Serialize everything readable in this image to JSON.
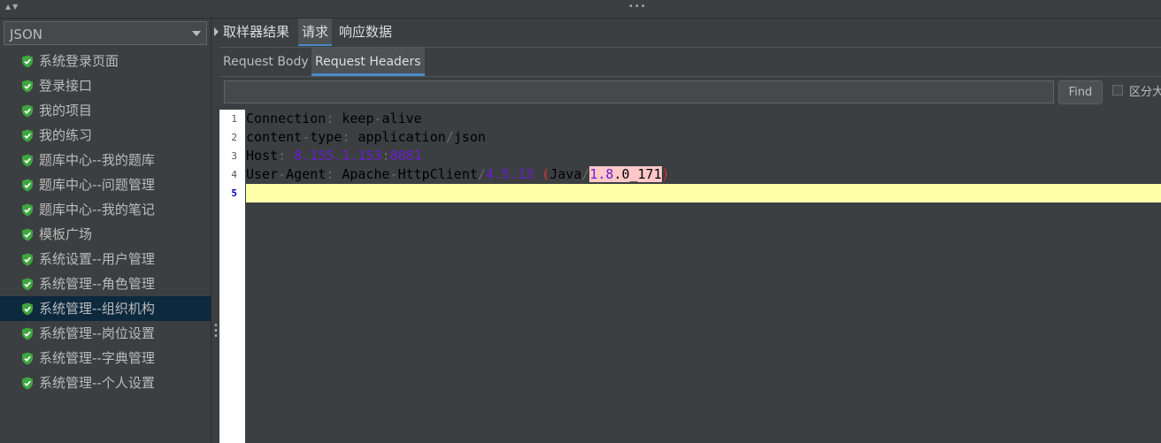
{
  "combo": {
    "value": "JSON"
  },
  "tree": [
    "系统登录页面",
    "登录接口",
    "我的项目",
    "我的练习",
    "题库中心--我的题库",
    "题库中心--问题管理",
    "题库中心--我的笔记",
    "模板广场",
    "系统设置--用户管理",
    "系统管理--角色管理",
    "系统管理--组织机构",
    "系统管理--岗位设置",
    "系统管理--字典管理",
    "系统管理--个人设置"
  ],
  "selected_index": 10,
  "tabs": [
    "取样器结果",
    "请求",
    "响应数据"
  ],
  "subtabs": [
    "Request Body",
    "Request Headers"
  ],
  "find": {
    "value": "",
    "button": "Find",
    "case_label": "区分大"
  },
  "line_numbers": [
    "1",
    "2",
    "3",
    "4",
    "5"
  ],
  "lines": {
    "l1": [
      "Connection",
      ": ",
      "keep",
      "-",
      "alive"
    ],
    "l2": [
      "content",
      "-",
      "type",
      ": ",
      "application",
      "/",
      "json"
    ],
    "l3": [
      "Host",
      ": ",
      "8.155.1.153",
      ":",
      "8081"
    ],
    "l4": [
      "User",
      "-",
      "Agent",
      ": ",
      "Apache",
      "-",
      "HttpClient",
      "/",
      "4.5.13",
      " ",
      "(",
      "Java",
      "/",
      "1.8",
      ".0_171",
      ")"
    ]
  },
  "colors": {
    "accent": "#4a88c7",
    "selected_bg": "#0d293e",
    "ok_icon": "#3ea63e",
    "current_line": "#ffffaa"
  }
}
